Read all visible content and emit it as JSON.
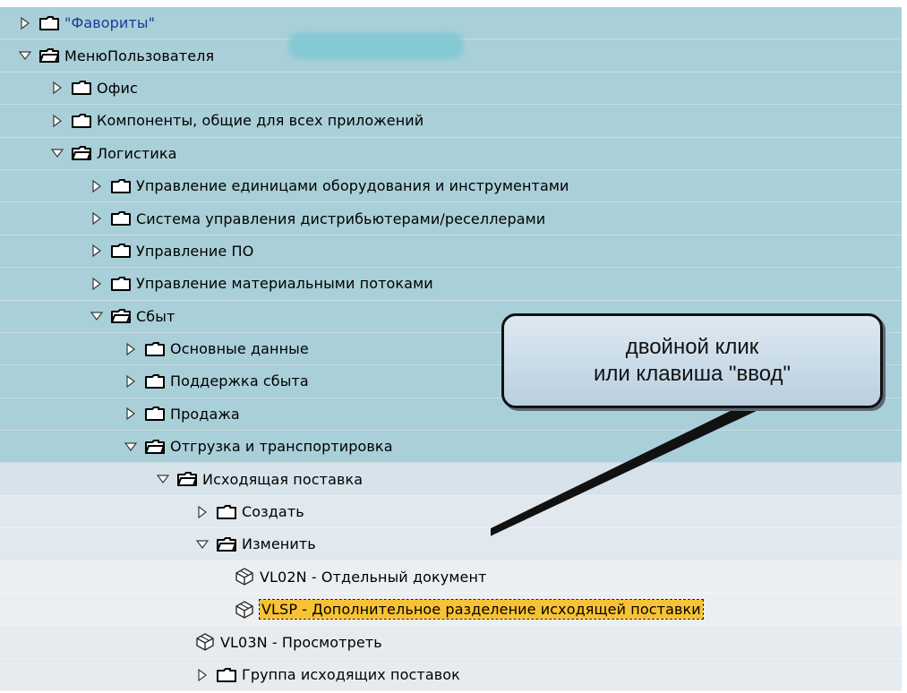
{
  "tree": [
    {
      "level": 0,
      "indent": 20,
      "kind": "folder",
      "expanded": false,
      "label": "\"Фавориты\"",
      "quoted": true,
      "band": "l0"
    },
    {
      "level": 0,
      "indent": 20,
      "kind": "folder",
      "expanded": true,
      "label": "МенюПользователя",
      "band": "l0"
    },
    {
      "level": 1,
      "indent": 56,
      "kind": "folder",
      "expanded": false,
      "label": "Офис",
      "band": "l1"
    },
    {
      "level": 1,
      "indent": 56,
      "kind": "folder",
      "expanded": false,
      "label": "Компоненты, общие для всех приложений",
      "band": "l1"
    },
    {
      "level": 1,
      "indent": 56,
      "kind": "folder",
      "expanded": true,
      "label": "Логистика",
      "band": "l1"
    },
    {
      "level": 2,
      "indent": 100,
      "kind": "folder",
      "expanded": false,
      "label": "Управление единицами оборудования и инструментами",
      "band": "l2"
    },
    {
      "level": 2,
      "indent": 100,
      "kind": "folder",
      "expanded": false,
      "label": "Система управления дистрибьютерами/реселлерами",
      "band": "l2"
    },
    {
      "level": 2,
      "indent": 100,
      "kind": "folder",
      "expanded": false,
      "label": "Управление ПО",
      "band": "l2"
    },
    {
      "level": 2,
      "indent": 100,
      "kind": "folder",
      "expanded": false,
      "label": "Управление материальными потоками",
      "band": "l2"
    },
    {
      "level": 2,
      "indent": 100,
      "kind": "folder",
      "expanded": true,
      "label": "Сбыт",
      "band": "l2"
    },
    {
      "level": 3,
      "indent": 138,
      "kind": "folder",
      "expanded": false,
      "label": "Основные данные",
      "band": "l3"
    },
    {
      "level": 3,
      "indent": 138,
      "kind": "folder",
      "expanded": false,
      "label": "Поддержка сбыта",
      "band": "l3"
    },
    {
      "level": 3,
      "indent": 138,
      "kind": "folder",
      "expanded": false,
      "label": "Продажа",
      "band": "l3"
    },
    {
      "level": 3,
      "indent": 138,
      "kind": "folder",
      "expanded": true,
      "label": "Отгрузка и транспортировка",
      "band": "l3"
    },
    {
      "level": 4,
      "indent": 174,
      "kind": "folder",
      "expanded": true,
      "label": "Исходящая поставка",
      "band": "l4"
    },
    {
      "level": 5,
      "indent": 218,
      "kind": "folder",
      "expanded": false,
      "label": "Создать",
      "band": "l5"
    },
    {
      "level": 5,
      "indent": 218,
      "kind": "folder",
      "expanded": true,
      "label": "Изменить",
      "band": "l5"
    },
    {
      "level": 6,
      "indent": 262,
      "kind": "transaction",
      "label": "VL02N - Отдельный документ",
      "band": "l6"
    },
    {
      "level": 6,
      "indent": 262,
      "kind": "transaction",
      "label": "VLSP - Дополнительное разделение исходящей поставки",
      "band": "l6",
      "selected": true
    },
    {
      "level": 5,
      "indent": 218,
      "kind": "transaction",
      "label": "VL03N - Просмотреть",
      "band": "l6b"
    },
    {
      "level": 5,
      "indent": 218,
      "kind": "folder",
      "expanded": false,
      "label": "Группа исходящих поставок",
      "band": "l6b"
    }
  ],
  "callout": {
    "line1": "двойной клик",
    "line2": "или клавиша \"ввод\""
  },
  "colors": {
    "selection": "#f8c234",
    "band_top": "#a9cfd8",
    "folder_fill": "#ffffff",
    "folder_stroke": "#000000"
  }
}
